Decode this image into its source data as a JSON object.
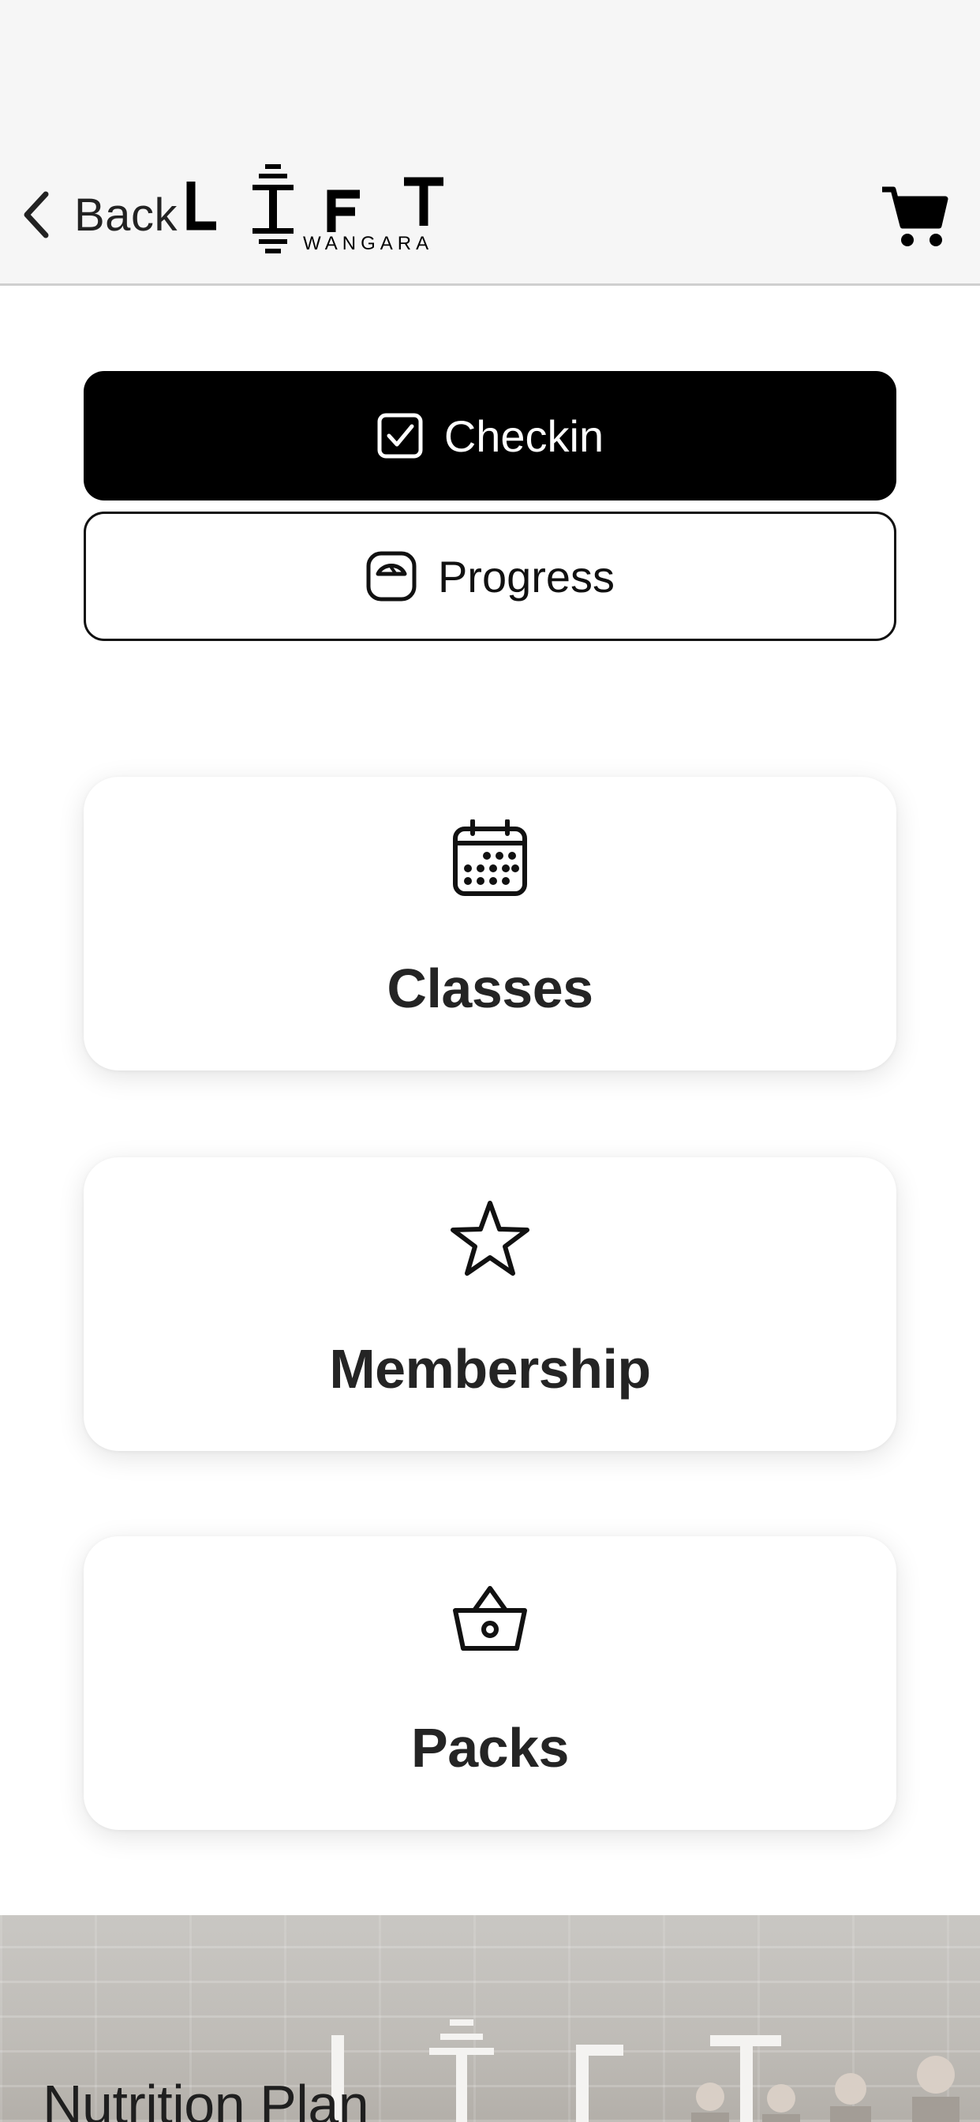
{
  "header": {
    "back_label": "Back",
    "logo": {
      "wordmark": "LIFT",
      "subtitle": "WANGARA"
    },
    "icons": {
      "back": "chevron-left-icon",
      "cart": "cart-icon"
    }
  },
  "actions": {
    "checkin": {
      "label": "Checkin",
      "icon": "checkbox-icon"
    },
    "progress": {
      "label": "Progress",
      "icon": "scale-icon"
    }
  },
  "menu": {
    "items": [
      {
        "label": "Classes",
        "icon": "calendar-icon"
      },
      {
        "label": "Membership",
        "icon": "star-icon"
      },
      {
        "label": "Packs",
        "icon": "basket-icon"
      }
    ]
  },
  "banner": {
    "title": "Nutrition Plan"
  },
  "colors": {
    "primary": "#000000",
    "header_bg": "#f6f6f6",
    "text": "#242424"
  }
}
